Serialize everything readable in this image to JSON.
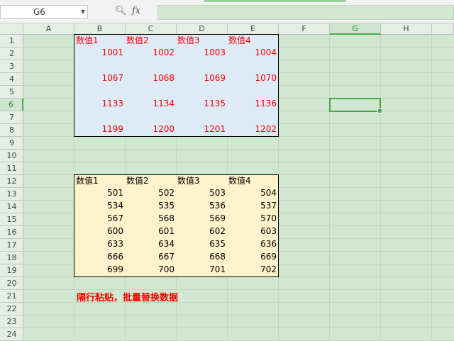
{
  "formula_bar": {
    "name_box": "G6",
    "fx_label": "fx",
    "formula": ""
  },
  "columns": [
    "A",
    "B",
    "C",
    "D",
    "E",
    "F",
    "G",
    "H"
  ],
  "selected_column": "G",
  "rows": [
    "1",
    "2",
    "3",
    "4",
    "5",
    "6",
    "7",
    "8",
    "9",
    "10",
    "11",
    "12",
    "13",
    "14",
    "15",
    "16",
    "17",
    "18",
    "19",
    "20",
    "21",
    "22",
    "23",
    "24"
  ],
  "selected_row": "6",
  "table1": {
    "headers": [
      "数值1",
      "数值2",
      "数值3",
      "数值4"
    ],
    "rows": [
      [
        "1001",
        "1002",
        "1003",
        "1004"
      ],
      [
        "",
        "",
        "",
        ""
      ],
      [
        "1067",
        "1068",
        "1069",
        "1070"
      ],
      [
        "",
        "",
        "",
        ""
      ],
      [
        "1133",
        "1134",
        "1135",
        "1136"
      ],
      [
        "",
        "",
        "",
        ""
      ],
      [
        "1199",
        "1200",
        "1201",
        "1202"
      ]
    ]
  },
  "table2": {
    "headers": [
      "数值1",
      "数值2",
      "数值3",
      "数值4"
    ],
    "rows": [
      [
        "501",
        "502",
        "503",
        "504"
      ],
      [
        "534",
        "535",
        "536",
        "537"
      ],
      [
        "567",
        "568",
        "569",
        "570"
      ],
      [
        "600",
        "601",
        "602",
        "603"
      ],
      [
        "633",
        "634",
        "635",
        "636"
      ],
      [
        "666",
        "667",
        "668",
        "669"
      ],
      [
        "699",
        "700",
        "701",
        "702"
      ]
    ]
  },
  "note": "隔行粘贴，批量替换数据",
  "colors": {
    "sheet_bg": "#cfe8cf",
    "table1_fill": "#ddebf7",
    "table1_text": "#ff0000",
    "table2_fill": "#fff2cc",
    "selection": "#4aa64a"
  }
}
